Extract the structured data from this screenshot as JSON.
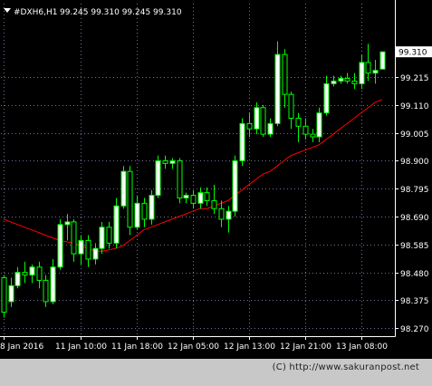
{
  "chart_data": {
    "type": "candlestick",
    "symbol_label": "#DXH6,H1",
    "ohlc_header": [
      "99.245",
      "99.310",
      "99.245",
      "99.310"
    ],
    "current_price": "99.310",
    "y_ticks": [
      99.215,
      99.11,
      99.005,
      98.9,
      98.795,
      98.69,
      98.585,
      98.48,
      98.375,
      98.27
    ],
    "y_tick_labels": [
      "99.215",
      "99.110",
      "99.005",
      "98.900",
      "98.795",
      "98.690",
      "98.585",
      "98.480",
      "98.375",
      "98.270"
    ],
    "ylim": [
      98.24,
      99.43
    ],
    "x_labels": [
      "8 Jan 2016",
      "11 Jan 10:00",
      "11 Jan 18:00",
      "12 Jan 05:00",
      "12 Jan 13:00",
      "12 Jan 21:00",
      "13 Jan 08:00"
    ],
    "x_label_candle_index": [
      0,
      11,
      19,
      27,
      35,
      43,
      51
    ],
    "candles": [
      [
        98.46,
        98.47,
        98.31,
        98.33
      ],
      [
        98.37,
        98.46,
        98.35,
        98.43
      ],
      [
        98.43,
        98.5,
        98.42,
        98.48
      ],
      [
        98.48,
        98.52,
        98.44,
        98.47
      ],
      [
        98.47,
        98.51,
        98.44,
        98.5
      ],
      [
        98.5,
        98.52,
        98.42,
        98.45
      ],
      [
        98.45,
        98.47,
        98.35,
        98.37
      ],
      [
        98.37,
        98.53,
        98.36,
        98.5
      ],
      [
        98.5,
        98.68,
        98.49,
        98.66
      ],
      [
        98.66,
        98.7,
        98.6,
        98.67
      ],
      [
        98.67,
        98.68,
        98.52,
        98.55
      ],
      [
        98.55,
        98.62,
        98.51,
        98.6
      ],
      [
        98.6,
        98.62,
        98.5,
        98.53
      ],
      [
        98.53,
        98.59,
        98.51,
        98.57
      ],
      [
        98.57,
        98.67,
        98.55,
        98.65
      ],
      [
        98.65,
        98.67,
        98.57,
        98.59
      ],
      [
        98.59,
        98.76,
        98.57,
        98.73
      ],
      [
        98.73,
        98.88,
        98.72,
        98.86
      ],
      [
        98.86,
        98.88,
        98.62,
        98.65
      ],
      [
        98.65,
        98.77,
        98.64,
        98.74
      ],
      [
        98.74,
        98.76,
        98.65,
        98.68
      ],
      [
        98.68,
        98.79,
        98.66,
        98.77
      ],
      [
        98.77,
        98.92,
        98.76,
        98.9
      ],
      [
        98.9,
        98.92,
        98.87,
        98.89
      ],
      [
        98.89,
        98.91,
        98.87,
        98.9
      ],
      [
        98.9,
        98.91,
        98.74,
        98.76
      ],
      [
        98.76,
        98.78,
        98.74,
        98.77
      ],
      [
        98.77,
        98.79,
        98.72,
        98.74
      ],
      [
        98.74,
        98.8,
        98.72,
        98.78
      ],
      [
        98.78,
        98.8,
        98.73,
        98.75
      ],
      [
        98.75,
        98.81,
        98.7,
        98.72
      ],
      [
        98.72,
        98.75,
        98.65,
        98.68
      ],
      [
        98.68,
        98.73,
        98.63,
        98.71
      ],
      [
        98.71,
        98.92,
        98.69,
        98.9
      ],
      [
        98.9,
        99.06,
        98.88,
        99.04
      ],
      [
        99.04,
        99.08,
        98.99,
        99.02
      ],
      [
        99.02,
        99.12,
        99.0,
        99.1
      ],
      [
        99.1,
        99.11,
        98.99,
        99.0
      ],
      [
        99.0,
        99.06,
        98.99,
        99.04
      ],
      [
        99.04,
        99.35,
        99.03,
        99.3
      ],
      [
        99.3,
        99.32,
        99.1,
        99.15
      ],
      [
        99.15,
        99.16,
        99.02,
        99.06
      ],
      [
        99.06,
        99.08,
        98.97,
        99.03
      ],
      [
        99.03,
        99.06,
        98.98,
        99.0
      ],
      [
        99.0,
        99.02,
        98.97,
        98.99
      ],
      [
        98.99,
        99.1,
        98.97,
        99.08
      ],
      [
        99.08,
        99.22,
        99.07,
        99.19
      ],
      [
        99.19,
        99.22,
        99.18,
        99.2
      ],
      [
        99.2,
        99.22,
        99.19,
        99.21
      ],
      [
        99.21,
        99.23,
        99.19,
        99.2
      ],
      [
        99.2,
        99.23,
        99.17,
        99.19
      ],
      [
        99.19,
        99.3,
        99.17,
        99.27
      ],
      [
        99.27,
        99.34,
        99.2,
        99.23
      ],
      [
        99.23,
        99.28,
        99.19,
        99.24
      ],
      [
        99.245,
        99.31,
        99.245,
        99.31
      ]
    ],
    "moving_average": [
      98.68,
      98.67,
      98.66,
      98.65,
      98.64,
      98.63,
      98.62,
      98.61,
      98.6,
      98.595,
      98.59,
      98.58,
      98.57,
      98.56,
      98.56,
      98.565,
      98.57,
      98.58,
      98.6,
      98.62,
      98.64,
      98.65,
      98.66,
      98.67,
      98.68,
      98.69,
      98.7,
      98.71,
      98.72,
      98.72,
      98.73,
      98.74,
      98.75,
      98.77,
      98.79,
      98.81,
      98.83,
      98.85,
      98.86,
      98.88,
      98.9,
      98.92,
      98.93,
      98.94,
      98.95,
      98.96,
      98.98,
      99.0,
      99.02,
      99.04,
      99.06,
      99.08,
      99.1,
      99.12,
      99.13
    ],
    "colors": {
      "background": "#000000",
      "bull_fill": "#ffffff",
      "bear_fill": "#000000",
      "candle_stroke": "#00ff00",
      "grid": "#6f6f9f",
      "moving_average": "#ff0000",
      "axis_text": "#ffffff",
      "price_tag_bg": "#ffffff",
      "price_tag_text": "#000000"
    },
    "grid": true
  },
  "footer": {
    "copyright": "(C) http://www.sakuranpost.net"
  }
}
